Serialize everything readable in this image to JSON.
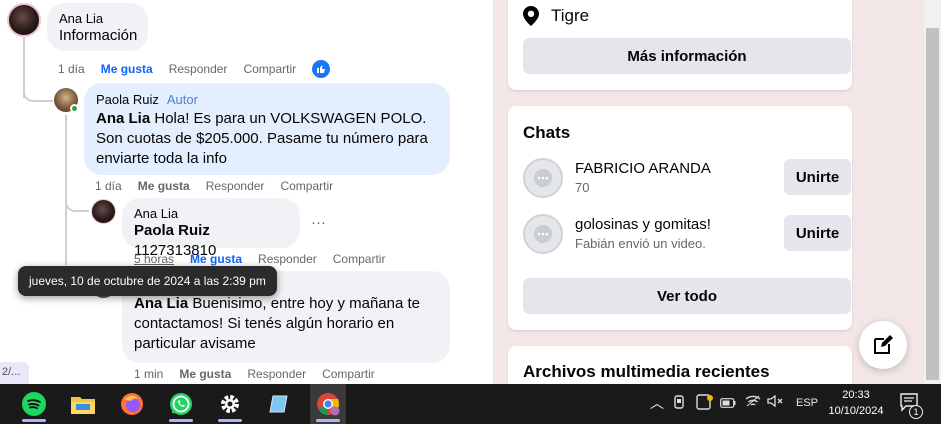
{
  "comments": {
    "c1": {
      "author": "Ana Lia",
      "text": "Información",
      "time": "1 día",
      "like": "Me gusta",
      "reply": "Responder",
      "share": "Compartir"
    },
    "c2": {
      "author": "Paola Ruiz",
      "badge": "Autor",
      "mention": "Ana Lia",
      "text": "Hola! Es para un VOLKSWAGEN POLO. Son cuotas de $205.000. Pasame tu número para enviarte toda la info",
      "time": "1 día",
      "like": "Me gusta",
      "reply": "Responder",
      "share": "Compartir"
    },
    "c3": {
      "author": "Ana Lia",
      "mention": "Paola Ruiz",
      "text": "1127313810",
      "time": "5 horas",
      "like": "Me gusta",
      "reply": "Responder",
      "share": "Compartir",
      "more": "···"
    },
    "c4": {
      "author": "Paola Ruiz",
      "mention": "Ana Lia",
      "text": "Buenisimo, entre hoy y mañana te contactamos! Si tenés algún horario en particular avisame",
      "time": "1 min",
      "like": "Me gusta",
      "reply": "Responder",
      "share": "Compartir"
    }
  },
  "tooltip": "jueves, 10 de octubre de 2024 a las 2:39 pm",
  "pager": "2/...",
  "info": {
    "location": "Tigre",
    "more_button": "Más información"
  },
  "chats": {
    "title": "Chats",
    "items": [
      {
        "name": "FABRICIO ARANDA",
        "sub": "70",
        "button": "Unirte"
      },
      {
        "name": "golosinas y gomitas!",
        "sub": "Fabián envió un video.",
        "button": "Unirte"
      }
    ],
    "see_all": "Ver todo"
  },
  "media": {
    "title": "Archivos multimedia recientes"
  },
  "taskbar": {
    "lang": "ESP",
    "time": "20:33",
    "date": "10/10/2024",
    "notif_count": "1"
  },
  "colors": {
    "like_blue": "#0866ff",
    "author_badge": "#4f7dd9",
    "taskbar": "#1a1a1a",
    "right_bg": "#f2e6e6"
  }
}
